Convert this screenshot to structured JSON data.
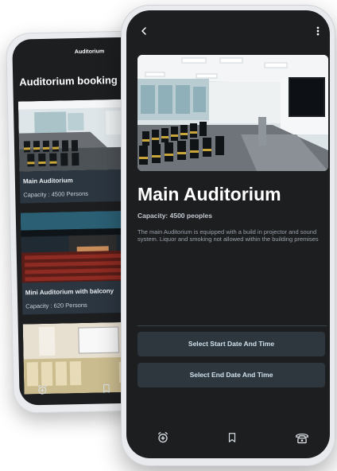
{
  "back_screen": {
    "header_title": "Auditorium",
    "page_title": "Auditorium booking",
    "cards": [
      {
        "name": "Main Auditorium",
        "capacity": "Capacity : 4500 Persons"
      },
      {
        "name": "Mini Auditorium with balcony",
        "capacity": "Capacity : 620 Persons"
      }
    ]
  },
  "front_screen": {
    "title": "Main Auditorium",
    "capacity": "Capacity: 4500 peoples",
    "description": "The main Auditorium is equipped with a build in projector and sound system. Liquor and smoking not allowed within the building premises",
    "start_button": "Select Start Date And Time",
    "end_button": "Select End Date And Time"
  },
  "icons": [
    "back-arrow-icon",
    "more-vert-icon",
    "alarm-add-icon",
    "bookmark-icon",
    "phone-icon"
  ],
  "colors": {
    "screen_bg": "#1d1e20",
    "button_bg": "#2e373e",
    "button_text": "#cfe0ec",
    "card_info_bg": "#2c3640"
  }
}
